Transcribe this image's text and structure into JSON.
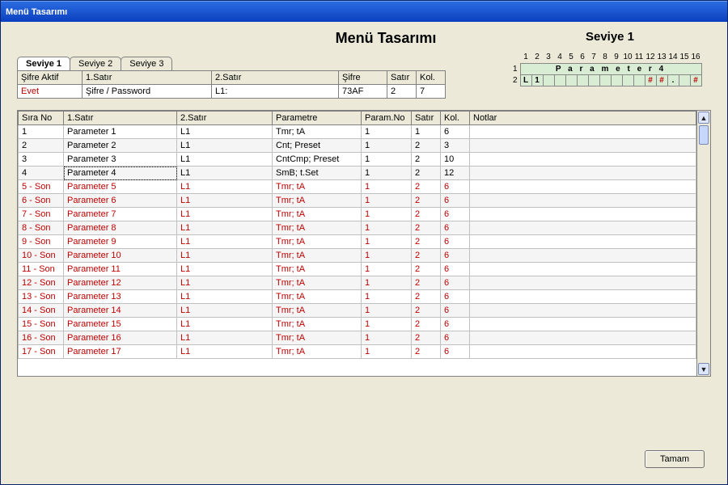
{
  "window": {
    "title": "Menü Tasarımı"
  },
  "header": {
    "main_title": "Menü Tasarımı",
    "seviye_title": "Seviye 1"
  },
  "tabs": [
    {
      "label": "Seviye 1"
    },
    {
      "label": "Seviye 2"
    },
    {
      "label": "Seviye 3"
    }
  ],
  "small_table": {
    "headers": {
      "col1": "Şifre Aktif",
      "col2": "1.Satır",
      "col3": "2.Satır",
      "col4": "Şifre",
      "col5": "Satır",
      "col6": "Kol."
    },
    "row": {
      "col1": "Evet",
      "col2": "Şifre / Password",
      "col3": "L1:",
      "col4": "73AF",
      "col5": "2",
      "col6": "7"
    }
  },
  "main_table": {
    "headers": {
      "c1": "Sıra No",
      "c2": "1.Satır",
      "c3": "2.Satır",
      "c4": "Parametre",
      "c5": "Param.No",
      "c6": "Satır",
      "c7": "Kol.",
      "c8": "Notlar"
    },
    "rows": [
      {
        "c1": "1",
        "c2": "Parameter 1",
        "c3": "L1",
        "c4": "Tmr; tA",
        "c5": "1",
        "c6": "1",
        "c7": "6",
        "red": false
      },
      {
        "c1": "2",
        "c2": "Parameter 2",
        "c3": "L1",
        "c4": "Cnt; Preset",
        "c5": "1",
        "c6": "2",
        "c7": "3",
        "red": false
      },
      {
        "c1": "3",
        "c2": "Parameter 3",
        "c3": "L1",
        "c4": "CntCmp; Preset",
        "c5": "1",
        "c6": "2",
        "c7": "10",
        "red": false
      },
      {
        "c1": "4",
        "c2": "Parameter 4",
        "c3": "L1",
        "c4": "SmB; t.Set",
        "c5": "1",
        "c6": "2",
        "c7": "12",
        "red": false,
        "selected": true
      },
      {
        "c1": "5 - Son",
        "c2": "Parameter 5",
        "c3": "L1",
        "c4": "Tmr; tA",
        "c5": "1",
        "c6": "2",
        "c7": "6",
        "red": true
      },
      {
        "c1": "6 - Son",
        "c2": "Parameter 6",
        "c3": "L1",
        "c4": "Tmr; tA",
        "c5": "1",
        "c6": "2",
        "c7": "6",
        "red": true
      },
      {
        "c1": "7 - Son",
        "c2": "Parameter 7",
        "c3": "L1",
        "c4": "Tmr; tA",
        "c5": "1",
        "c6": "2",
        "c7": "6",
        "red": true
      },
      {
        "c1": "8 - Son",
        "c2": "Parameter 8",
        "c3": "L1",
        "c4": "Tmr; tA",
        "c5": "1",
        "c6": "2",
        "c7": "6",
        "red": true
      },
      {
        "c1": "9 - Son",
        "c2": "Parameter 9",
        "c3": "L1",
        "c4": "Tmr; tA",
        "c5": "1",
        "c6": "2",
        "c7": "6",
        "red": true
      },
      {
        "c1": "10 - Son",
        "c2": "Parameter 10",
        "c3": "L1",
        "c4": "Tmr; tA",
        "c5": "1",
        "c6": "2",
        "c7": "6",
        "red": true
      },
      {
        "c1": "11 - Son",
        "c2": "Parameter 11",
        "c3": "L1",
        "c4": "Tmr; tA",
        "c5": "1",
        "c6": "2",
        "c7": "6",
        "red": true
      },
      {
        "c1": "12 - Son",
        "c2": "Parameter 12",
        "c3": "L1",
        "c4": "Tmr; tA",
        "c5": "1",
        "c6": "2",
        "c7": "6",
        "red": true
      },
      {
        "c1": "13 - Son",
        "c2": "Parameter 13",
        "c3": "L1",
        "c4": "Tmr; tA",
        "c5": "1",
        "c6": "2",
        "c7": "6",
        "red": true
      },
      {
        "c1": "14 - Son",
        "c2": "Parameter 14",
        "c3": "L1",
        "c4": "Tmr; tA",
        "c5": "1",
        "c6": "2",
        "c7": "6",
        "red": true
      },
      {
        "c1": "15 - Son",
        "c2": "Parameter 15",
        "c3": "L1",
        "c4": "Tmr; tA",
        "c5": "1",
        "c6": "2",
        "c7": "6",
        "red": true
      },
      {
        "c1": "16 - Son",
        "c2": "Parameter 16",
        "c3": "L1",
        "c4": "Tmr; tA",
        "c5": "1",
        "c6": "2",
        "c7": "6",
        "red": true
      },
      {
        "c1": "17 - Son",
        "c2": "Parameter 17",
        "c3": "L1",
        "c4": "Tmr; tA",
        "c5": "1",
        "c6": "2",
        "c7": "6",
        "red": true
      }
    ]
  },
  "preview": {
    "cols": [
      "1",
      "2",
      "3",
      "4",
      "5",
      "6",
      "7",
      "8",
      "9",
      "10",
      "11",
      "12",
      "13",
      "14",
      "15",
      "16"
    ],
    "rows": [
      {
        "label": "1",
        "cells": [
          "",
          "P",
          "a",
          "r",
          "a",
          "m",
          "e",
          "t",
          "e",
          "r",
          "",
          "4",
          "",
          "",
          "",
          ""
        ],
        "span_text": "P a r a m e t e r   4"
      },
      {
        "label": "2",
        "cells": [
          "L",
          "1",
          "",
          "",
          "",
          "",
          "",
          "",
          "",
          "",
          "",
          "#",
          "#",
          ".",
          "",
          "#"
        ],
        "hash_cols": [
          12,
          13,
          16
        ]
      }
    ]
  },
  "buttons": {
    "ok": "Tamam"
  }
}
